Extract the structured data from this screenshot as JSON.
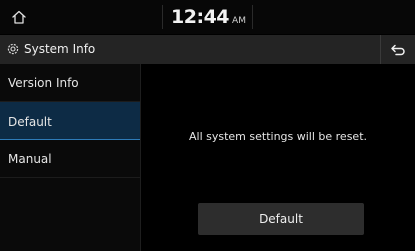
{
  "status_bar": {
    "time": "12:44",
    "ampm": "AM"
  },
  "header": {
    "title": "System Info"
  },
  "sidebar": {
    "items": [
      {
        "label": "Version Info",
        "selected": false
      },
      {
        "label": "Default",
        "selected": true
      },
      {
        "label": "Manual",
        "selected": false
      }
    ]
  },
  "main": {
    "message": "All system settings will be reset.",
    "default_button_label": "Default"
  },
  "icons": {
    "home": "home-icon",
    "settings": "gear-icon",
    "back": "back-arrow-icon"
  },
  "colors": {
    "selected_background": "#0d2b45",
    "selected_underline": "#2e7bb8",
    "title_bar": "#242424"
  }
}
